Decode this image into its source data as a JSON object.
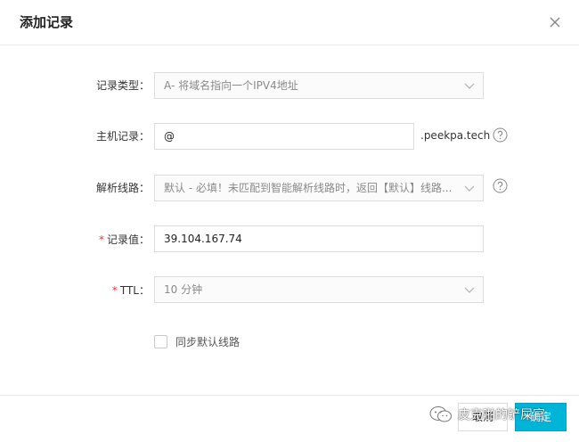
{
  "dialog": {
    "title": "添加记录"
  },
  "form": {
    "record_type": {
      "label": "记录类型：",
      "value": "A- 将域名指向一个IPV4地址"
    },
    "host": {
      "label": "主机记录：",
      "value": "@",
      "suffix": ".peekpa.tech"
    },
    "line": {
      "label": "解析线路：",
      "value": "默认 - 必填！未匹配到智能解析线路时，返回【默认】线路..."
    },
    "value": {
      "required_mark": "*",
      "label": "记录值：",
      "value": "39.104.167.74"
    },
    "ttl": {
      "required_mark": "*",
      "label": "TTL：",
      "value": "10 分钟"
    },
    "sync": {
      "label": "同步默认线路",
      "checked": false
    }
  },
  "buttons": {
    "cancel": "取消",
    "ok": "确定"
  },
  "watermark": {
    "text": "皮克啪的铲屎官"
  },
  "colors": {
    "primary": "#00b4d8",
    "required": "#e4393c",
    "border": "#dcdcdc"
  }
}
